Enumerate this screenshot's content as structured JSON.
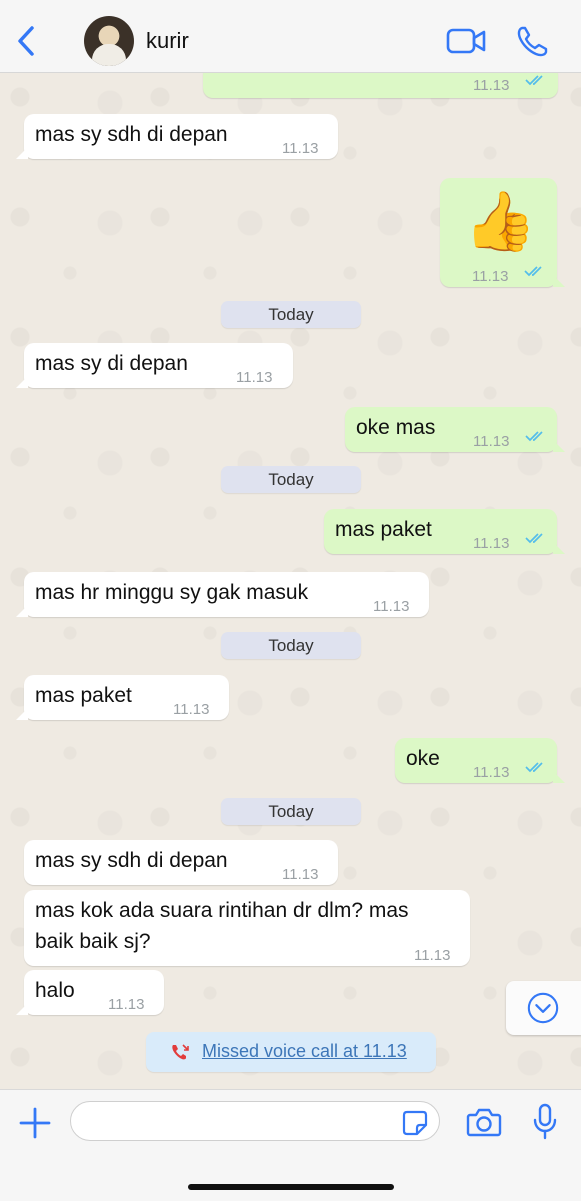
{
  "header": {
    "contact_name": "kurir",
    "accent_color": "#3478f6"
  },
  "messages": [
    {
      "id": "m0",
      "direction": "out",
      "text": "",
      "time": "11.13",
      "read": true
    },
    {
      "id": "m1",
      "direction": "in",
      "text": "mas sy sdh di depan",
      "time": "11.13"
    },
    {
      "id": "m2",
      "direction": "out",
      "text": "👍",
      "time": "11.13",
      "read": true
    },
    {
      "id": "d1",
      "type": "date",
      "text": "Today"
    },
    {
      "id": "m3",
      "direction": "in",
      "text": "mas sy di depan",
      "time": "11.13"
    },
    {
      "id": "m4",
      "direction": "out",
      "text": "oke mas",
      "time": "11.13",
      "read": true
    },
    {
      "id": "d2",
      "type": "date",
      "text": "Today"
    },
    {
      "id": "m5",
      "direction": "out",
      "text": "mas paket",
      "time": "11.13",
      "read": true
    },
    {
      "id": "m6",
      "direction": "in",
      "text": "mas hr minggu sy gak masuk",
      "time": "11.13"
    },
    {
      "id": "d3",
      "type": "date",
      "text": "Today"
    },
    {
      "id": "m7",
      "direction": "in",
      "text": "mas paket",
      "time": "11.13"
    },
    {
      "id": "m8",
      "direction": "out",
      "text": "oke",
      "time": "11.13",
      "read": true
    },
    {
      "id": "d4",
      "type": "date",
      "text": "Today"
    },
    {
      "id": "m9",
      "direction": "in",
      "text": "mas sy sdh di depan",
      "time": "11.13"
    },
    {
      "id": "m10",
      "direction": "in",
      "lines": [
        "mas kok ada suara rintihan dr dlm? mas",
        "baik baik sj?"
      ],
      "time": "11.13"
    },
    {
      "id": "m11",
      "direction": "in",
      "text": "halo",
      "time": "11.13"
    }
  ],
  "missed_call": {
    "text": "Missed voice call at 11.13",
    "icon": "missed-call-icon"
  },
  "composer": {
    "placeholder": "",
    "icons": [
      "plus-icon",
      "sticker-icon",
      "camera-icon",
      "mic-icon"
    ]
  },
  "colors": {
    "outgoing_bubble": "#dcf8c6",
    "incoming_bubble": "#ffffff",
    "read_ticks": "#53bdeb",
    "missed_call_red": "#e23c3c"
  }
}
